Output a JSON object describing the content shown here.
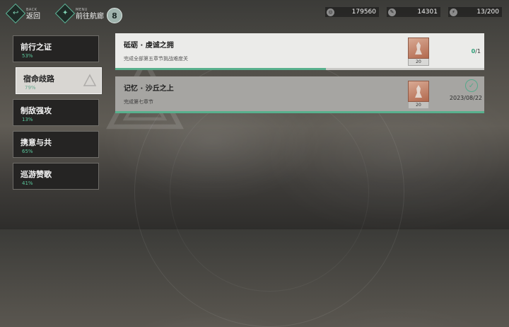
{
  "topbar": {
    "back": {
      "small": "BACK",
      "label": "返回",
      "icon": "back-arrow-icon"
    },
    "menu": {
      "small": "MENU",
      "label": "前往航廊",
      "icon": "menu-icon"
    },
    "badge": "8"
  },
  "resources": [
    {
      "name": "coin-icon",
      "value": "179560"
    },
    {
      "name": "feather-icon",
      "value": "14301"
    },
    {
      "name": "stamina-icon",
      "value": "13/200"
    }
  ],
  "sidebar": {
    "items": [
      {
        "title": "前行之证",
        "percent": "53%"
      },
      {
        "title": "宿命歧路",
        "percent": "79%"
      },
      {
        "title": "制敌强攻",
        "percent": "13%"
      },
      {
        "title": "携意与共",
        "percent": "65%"
      },
      {
        "title": "巡游赞歌",
        "percent": "41%"
      }
    ],
    "active_index": 1
  },
  "tasks": [
    {
      "title": "砥砺 · 虔诚之拥",
      "desc": "完成全部第五章节挑战难度关",
      "reward_count": "20",
      "progress_done": "0",
      "progress_total": "/1",
      "progress_fraction": 0.57
    },
    {
      "title": "记忆 · 沙丘之上",
      "desc": "完成第七章节",
      "reward_count": "20",
      "completed_date": "2023/08/22",
      "progress_fraction": 1.0
    }
  ],
  "colors": {
    "accent": "#58b08d",
    "active_tab": "#d8d6d2",
    "tab": "#252423"
  }
}
